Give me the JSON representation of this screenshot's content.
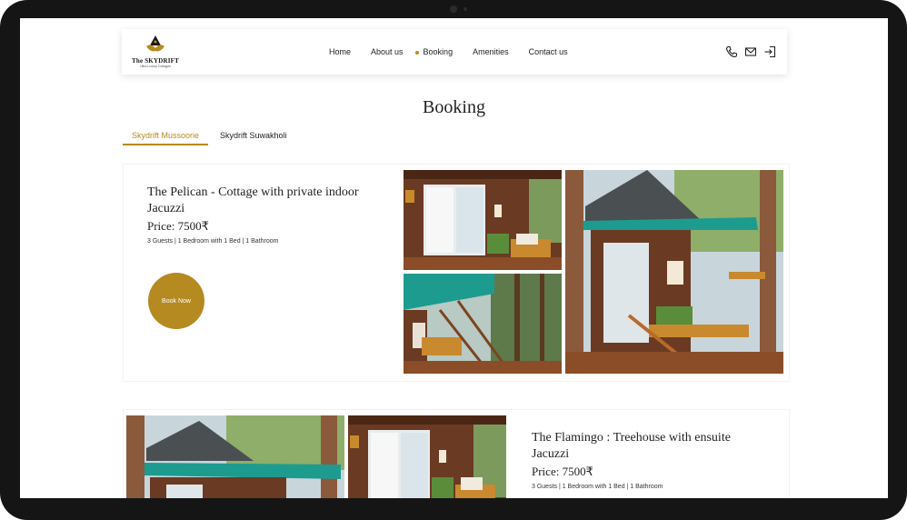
{
  "header": {
    "brand_name": "The SKYDRIFT",
    "brand_tagline": "Ultra Luxury Cottages",
    "nav": [
      {
        "label": "Home"
      },
      {
        "label": "About us"
      },
      {
        "label": "Booking"
      },
      {
        "label": "Amenities"
      },
      {
        "label": "Contact us"
      }
    ],
    "active_nav": "Booking",
    "icons": [
      "phone-icon",
      "mail-icon",
      "login-icon"
    ]
  },
  "page": {
    "title": "Booking"
  },
  "tabs": [
    {
      "label": "Skydrift Mussoorie",
      "active": true
    },
    {
      "label": "Skydrift Suwakholi",
      "active": false
    }
  ],
  "listings": [
    {
      "title": "The Pelican - Cottage with private indoor Jacuzzi",
      "price": "Price: 7500₹",
      "details": "3 Guests | 1 Bedroom with 1 Bed | 1 Bathroom",
      "cta": "Book Now"
    },
    {
      "title": "The Flamingo : Treehouse with ensuite Jacuzzi",
      "price": "Price: 7500₹",
      "details": "3 Guests | 1 Bedroom with 1 Bed | 1 Bathroom"
    }
  ],
  "colors": {
    "accent": "#b58a21",
    "teal_roof": "#1e9b8f",
    "wood": "#6b3a22"
  }
}
